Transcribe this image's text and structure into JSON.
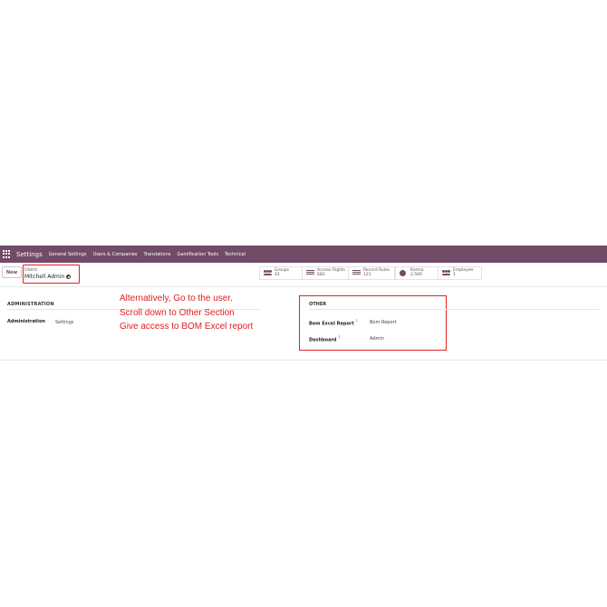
{
  "navbar": {
    "app_title": "Settings",
    "menu": [
      "General Settings",
      "Users & Companies",
      "Translations",
      "Gamification Tools",
      "Technical"
    ]
  },
  "control": {
    "new_label": "New",
    "breadcrumb_parent": "Users",
    "breadcrumb_current": "Mitchell Admin"
  },
  "stats": [
    {
      "label": "Groups",
      "value": "42",
      "icon": "users-icon"
    },
    {
      "label": "Access Rights",
      "value": "682",
      "icon": "list-icon"
    },
    {
      "label": "Record Rules",
      "value": "121",
      "icon": "list-icon"
    },
    {
      "label": "Karma",
      "value": "2,500",
      "icon": "star-icon"
    },
    {
      "label": "Employee",
      "value": "1",
      "icon": "users-icon"
    }
  ],
  "administration": {
    "title": "ADMINISTRATION",
    "field_label": "Administration",
    "field_value": "Settings"
  },
  "annotation": [
    "Alternatively, Go to the user.",
    "Scroll down to Other Section",
    "Give access to BOM Excel report"
  ],
  "other": {
    "title": "OTHER",
    "fields": [
      {
        "label": "Bom Excel Report",
        "help": "?",
        "value": "Bom Report"
      },
      {
        "label": "Dashboard",
        "help": "?",
        "value": "Admin"
      }
    ]
  },
  "colors": {
    "brand": "#714b67",
    "highlight": "#e52020",
    "help": "#017e84"
  }
}
